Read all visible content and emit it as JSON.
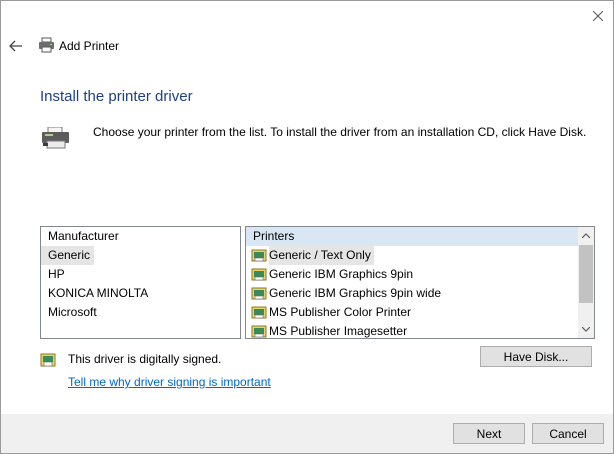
{
  "window": {
    "title": "Add Printer"
  },
  "heading": "Install the printer driver",
  "intro": "Choose your printer from the list. To install the driver from an installation CD, click Have Disk.",
  "manufacturer": {
    "header": "Manufacturer",
    "items": [
      "Generic",
      "HP",
      "KONICA MINOLTA",
      "Microsoft"
    ],
    "selected": "Generic"
  },
  "printers": {
    "header": "Printers",
    "items": [
      "Generic / Text Only",
      "Generic IBM Graphics 9pin",
      "Generic IBM Graphics 9pin wide",
      "MS Publisher Color Printer",
      "MS Publisher Imagesetter"
    ],
    "selected": "Generic / Text Only"
  },
  "signing": {
    "status": "This driver is digitally signed.",
    "link": "Tell me why driver signing is important"
  },
  "buttons": {
    "have_disk": "Have Disk...",
    "next": "Next",
    "cancel": "Cancel"
  },
  "colors": {
    "heading": "#1e3f87",
    "link": "#0066cc",
    "header_highlight": "#d9e7f4",
    "selection": "#e5e5e5"
  },
  "icons": [
    "close-icon",
    "back-arrow-icon",
    "printer-icon",
    "printer-install-icon",
    "printer-driver-icon",
    "signed-driver-icon",
    "scroll-up-icon",
    "scroll-down-icon"
  ]
}
